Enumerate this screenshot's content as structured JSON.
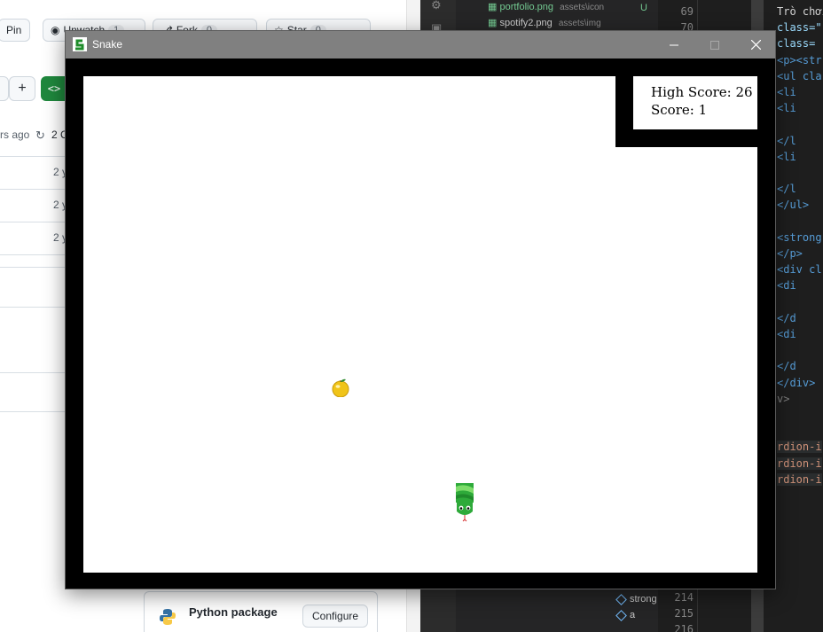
{
  "github": {
    "pin_label": "Pin",
    "unwatch_label": "Unwatch",
    "unwatch_count": "1",
    "fork_label": "Fork",
    "fork_count": "0",
    "star_label": "Star",
    "star_count": "0",
    "code_button": "<>",
    "meta_ago": "rs ago",
    "meta_commits": "2 C",
    "row_times": [
      "2 y",
      "2 y",
      "2 y"
    ],
    "python_card": {
      "name": "Python package",
      "configure_label": "Configure"
    }
  },
  "vscode": {
    "explorer_files": [
      {
        "name": "portfolio.png",
        "path": "assets\\icon",
        "status": "U"
      },
      {
        "name": "spotify2.png",
        "path": "assets\\img"
      }
    ],
    "outline_items": [
      "strong",
      "a"
    ],
    "line_numbers_top": [
      "69",
      "70"
    ],
    "line_numbers_bottom": [
      "214",
      "215",
      "216"
    ],
    "code_lines": [
      "Trò chơi",
      "class=\"",
      " class=",
      "<p><str",
      "<ul cla",
      "  <li",
      "  <li",
      "",
      "  </l",
      "  <li",
      "",
      "  </l",
      "</ul>",
      "",
      "<strong",
      "</p>",
      "<div cl",
      "  <di",
      "",
      "  </d",
      "  <di",
      "",
      "  </d",
      "</div>",
      "v>",
      "",
      "",
      "rdion-i",
      "rdion-i",
      "rdion-i"
    ]
  },
  "snake": {
    "title": "Snake",
    "high_score_text": "High Score: 26",
    "score_text": "Score: 1",
    "high_score": 26,
    "score": 1,
    "colors": {
      "titlebar": "#808080",
      "border": "#000000",
      "field": "#ffffff",
      "snake": "#2eaa3a",
      "food": "#f5c518"
    }
  }
}
